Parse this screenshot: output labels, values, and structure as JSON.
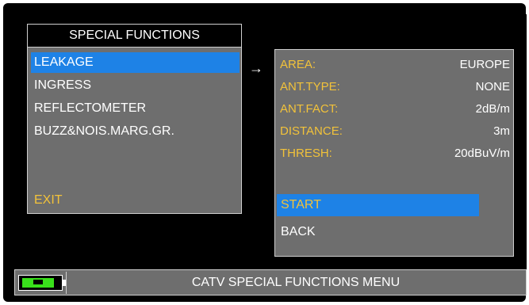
{
  "menu": {
    "title": "SPECIAL FUNCTIONS",
    "items": [
      {
        "label": "LEAKAGE",
        "selected": true
      },
      {
        "label": "INGRESS"
      },
      {
        "label": "REFLECTOMETER"
      },
      {
        "label": "BUZZ&NOIS.MARG.GR."
      }
    ],
    "exit_label": "EXIT"
  },
  "arrow_glyph": "→",
  "params": {
    "rows": [
      {
        "label": "AREA:",
        "value": "EUROPE"
      },
      {
        "label": "ANT.TYPE:",
        "value": "NONE"
      },
      {
        "label": "ANT.FACT:",
        "value": "2dB/m"
      },
      {
        "label": "DISTANCE:",
        "value": "3m"
      },
      {
        "label": "THRESH:",
        "value": "20dBuV/m"
      }
    ],
    "start_label": "START",
    "back_label": "BACK"
  },
  "status": {
    "title": "CATV SPECIAL FUNCTIONS MENU",
    "battery_icon": "battery-icon"
  },
  "colors": {
    "panel": "#6e6e6e",
    "highlight": "#1e82e6",
    "label_yellow": "#f2c23a",
    "battery_green": "#39e01b"
  }
}
